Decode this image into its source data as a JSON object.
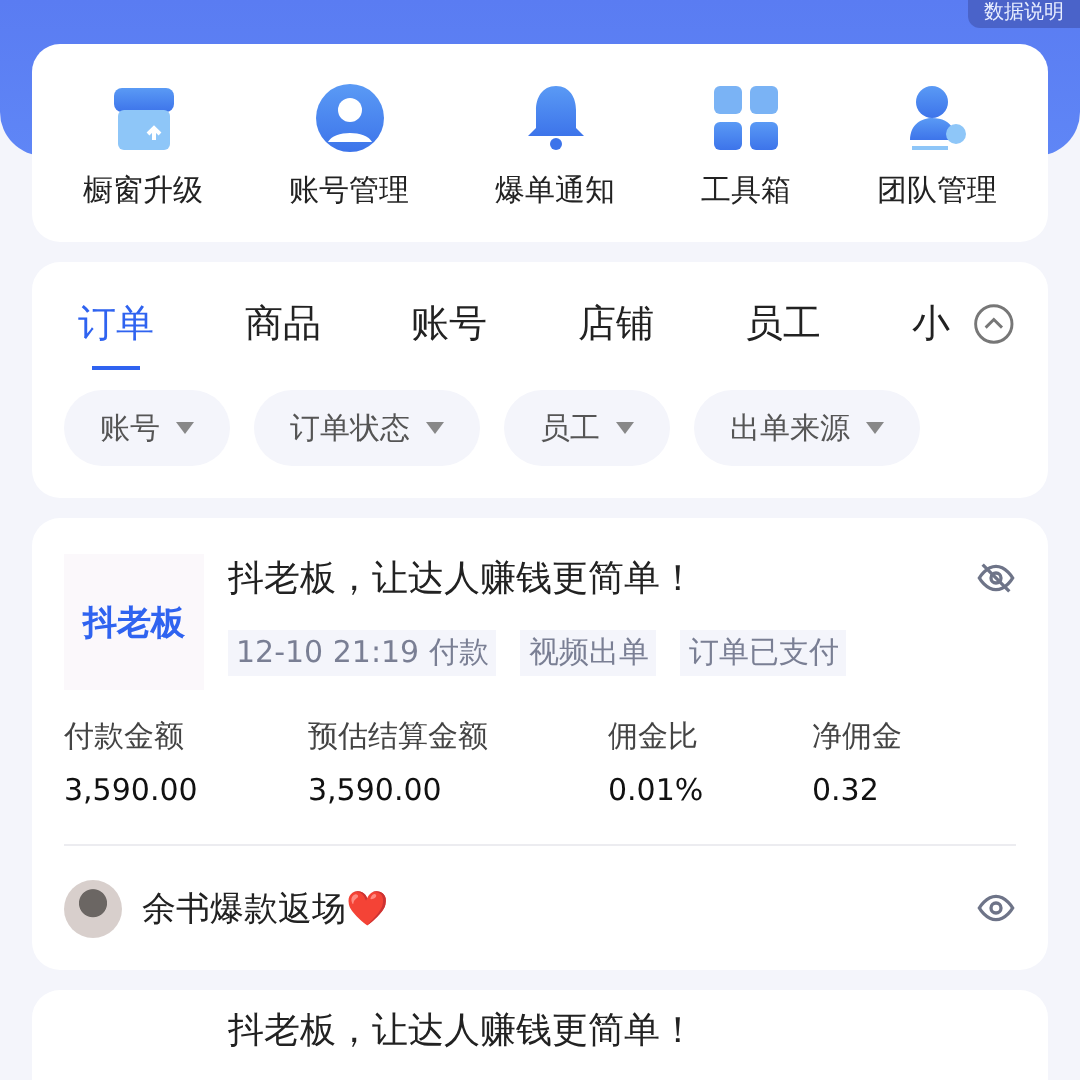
{
  "header": {
    "info_button": "数据说明"
  },
  "shortcuts": [
    {
      "kind": "store",
      "label": "橱窗升级"
    },
    {
      "kind": "account",
      "label": "账号管理"
    },
    {
      "kind": "bell",
      "label": "爆单通知"
    },
    {
      "kind": "grid",
      "label": "工具箱"
    },
    {
      "kind": "team",
      "label": "团队管理"
    }
  ],
  "tabs": [
    {
      "label": "订单",
      "selected": true
    },
    {
      "label": "商品",
      "selected": false
    },
    {
      "label": "账号",
      "selected": false
    },
    {
      "label": "店铺",
      "selected": false
    },
    {
      "label": "员工",
      "selected": false
    },
    {
      "label": "小",
      "selected": false
    }
  ],
  "filters": [
    "账号",
    "订单状态",
    "员工",
    "出单来源"
  ],
  "orders": [
    {
      "logo": "抖老板",
      "title": "抖老板，让达人赚钱更简单！",
      "tags": [
        "12-10 21:19 付款",
        "视频出单",
        "订单已支付"
      ],
      "hidden": true,
      "metrics": [
        {
          "label": "付款金额",
          "value": "3,590.00"
        },
        {
          "label": "预估结算金额",
          "value": "3,590.00"
        },
        {
          "label": "佣金比",
          "value": "0.01%"
        },
        {
          "label": "净佣金",
          "value": "0.32"
        }
      ],
      "creator": "余书爆款返场❤️"
    },
    {
      "title": "抖老板，让达人赚钱更简单！"
    }
  ]
}
